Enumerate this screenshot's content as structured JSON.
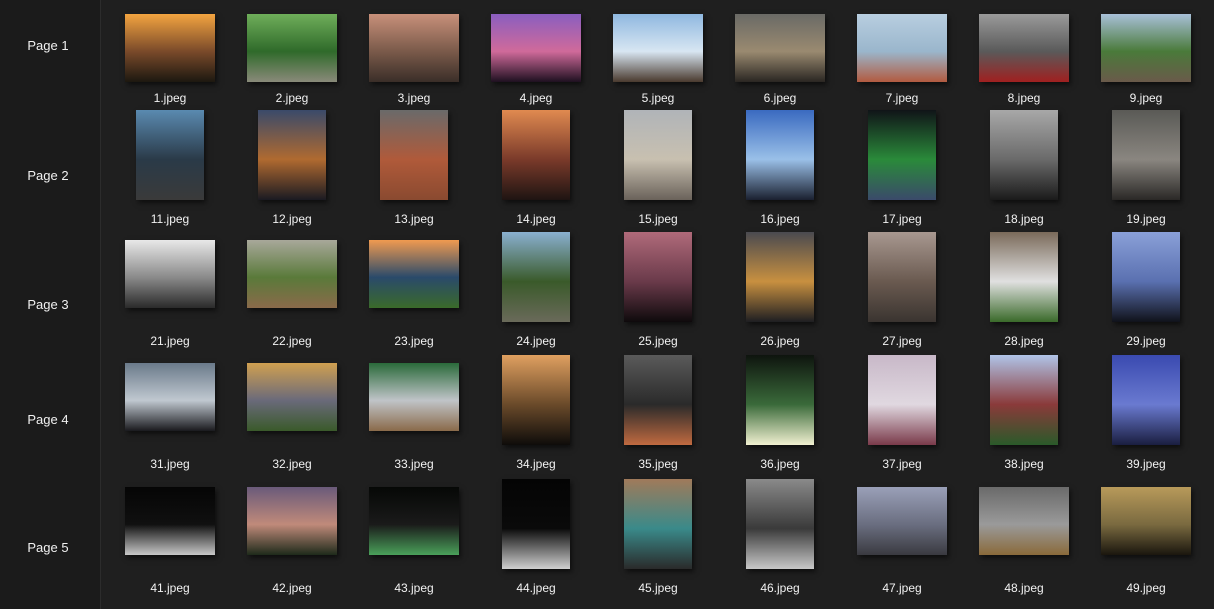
{
  "pages": [
    {
      "label": "Page 1",
      "files": [
        {
          "name": "1.jpeg",
          "orient": "landscape",
          "colors": [
            "#f3a440",
            "#7a4a2a",
            "#1c1810"
          ]
        },
        {
          "name": "2.jpeg",
          "orient": "landscape",
          "colors": [
            "#6fae5a",
            "#2f6a2a",
            "#8a8a7a"
          ]
        },
        {
          "name": "3.jpeg",
          "orient": "landscape",
          "colors": [
            "#c8907a",
            "#7a5a4a",
            "#3a2e28"
          ]
        },
        {
          "name": "4.jpeg",
          "orient": "landscape",
          "colors": [
            "#8a5ec0",
            "#d06a9a",
            "#1e1020"
          ]
        },
        {
          "name": "5.jpeg",
          "orient": "landscape",
          "colors": [
            "#8fb8e0",
            "#d8e6f2",
            "#4a3a2e"
          ]
        },
        {
          "name": "6.jpeg",
          "orient": "landscape",
          "colors": [
            "#6a6a66",
            "#9a8a70",
            "#2a2622"
          ]
        },
        {
          "name": "7.jpeg",
          "orient": "landscape",
          "colors": [
            "#b8cee0",
            "#9ab6cc",
            "#b25a40"
          ]
        },
        {
          "name": "8.jpeg",
          "orient": "landscape",
          "colors": [
            "#9a9a9a",
            "#5a5a5a",
            "#a02020"
          ]
        },
        {
          "name": "9.jpeg",
          "orient": "landscape",
          "colors": [
            "#a8c0d8",
            "#4a7a3a",
            "#6a5a4a"
          ]
        }
      ]
    },
    {
      "label": "Page 2",
      "files": [
        {
          "name": "11.jpeg",
          "orient": "portrait",
          "colors": [
            "#5a8ab0",
            "#2a3a48",
            "#3a3a3a"
          ]
        },
        {
          "name": "12.jpeg",
          "orient": "portrait",
          "colors": [
            "#3a4a6a",
            "#b06a30",
            "#1a1a22"
          ]
        },
        {
          "name": "13.jpeg",
          "orient": "portrait",
          "colors": [
            "#6a6a6a",
            "#b05a3a",
            "#8a4a30"
          ]
        },
        {
          "name": "14.jpeg",
          "orient": "portrait",
          "colors": [
            "#e08a50",
            "#7a3a2a",
            "#1e1412"
          ]
        },
        {
          "name": "15.jpeg",
          "orient": "portrait",
          "colors": [
            "#b0b4b8",
            "#c8c0b0",
            "#6a625a"
          ]
        },
        {
          "name": "16.jpeg",
          "orient": "portrait",
          "colors": [
            "#3a6ac0",
            "#9ac0e8",
            "#1a2030"
          ]
        },
        {
          "name": "17.jpeg",
          "orient": "portrait",
          "colors": [
            "#101418",
            "#2a8a3a",
            "#3a4a6a"
          ]
        },
        {
          "name": "18.jpeg",
          "orient": "portrait",
          "colors": [
            "#a8a8a8",
            "#6a6a6a",
            "#1a1a1a"
          ]
        },
        {
          "name": "19.jpeg",
          "orient": "portrait",
          "colors": [
            "#5a5a56",
            "#8a8680",
            "#2a2826"
          ]
        }
      ]
    },
    {
      "label": "Page 3",
      "files": [
        {
          "name": "21.jpeg",
          "orient": "landscape",
          "colors": [
            "#e8e8e8",
            "#8a8a8a",
            "#2a2a2a"
          ]
        },
        {
          "name": "22.jpeg",
          "orient": "landscape",
          "colors": [
            "#a8a89a",
            "#5a7a3a",
            "#8a6a4a"
          ]
        },
        {
          "name": "23.jpeg",
          "orient": "landscape",
          "colors": [
            "#f09a50",
            "#2a4a6a",
            "#3a6a2a"
          ]
        },
        {
          "name": "24.jpeg",
          "orient": "portrait",
          "colors": [
            "#8ab0d0",
            "#3a5a2a",
            "#6a6a5a"
          ]
        },
        {
          "name": "25.jpeg",
          "orient": "portrait",
          "colors": [
            "#b06a7a",
            "#6a3a4a",
            "#0e0a0c"
          ]
        },
        {
          "name": "26.jpeg",
          "orient": "portrait",
          "colors": [
            "#4a4a50",
            "#c89040",
            "#1e1e22"
          ]
        },
        {
          "name": "27.jpeg",
          "orient": "portrait",
          "colors": [
            "#a89890",
            "#6a5a50",
            "#3a3430"
          ]
        },
        {
          "name": "28.jpeg",
          "orient": "portrait",
          "colors": [
            "#7a6a5a",
            "#e0e0e0",
            "#3a6a2a"
          ]
        },
        {
          "name": "29.jpeg",
          "orient": "portrait",
          "colors": [
            "#8aa0d8",
            "#5a70b0",
            "#10121a"
          ]
        }
      ]
    },
    {
      "label": "Page 4",
      "files": [
        {
          "name": "31.jpeg",
          "orient": "landscape",
          "colors": [
            "#6a7a8a",
            "#c0c8d0",
            "#1a1a1e"
          ]
        },
        {
          "name": "32.jpeg",
          "orient": "landscape",
          "colors": [
            "#d0a050",
            "#6a6a7a",
            "#3a5a2a"
          ]
        },
        {
          "name": "33.jpeg",
          "orient": "landscape",
          "colors": [
            "#2a6a3a",
            "#c0c4c8",
            "#8a6a4a"
          ]
        },
        {
          "name": "34.jpeg",
          "orient": "portrait",
          "colors": [
            "#e0a060",
            "#6a4a2a",
            "#0e0c0a"
          ]
        },
        {
          "name": "35.jpeg",
          "orient": "portrait",
          "colors": [
            "#5a5a5a",
            "#2a2a2a",
            "#c06a40"
          ]
        },
        {
          "name": "36.jpeg",
          "orient": "portrait",
          "colors": [
            "#0e140e",
            "#3a6a3a",
            "#f0f0d0"
          ]
        },
        {
          "name": "37.jpeg",
          "orient": "portrait",
          "colors": [
            "#c8b8c8",
            "#e0d8e0",
            "#7a3a4a"
          ]
        },
        {
          "name": "38.jpeg",
          "orient": "portrait",
          "colors": [
            "#b0c4e8",
            "#8a3a3a",
            "#2a5a2a"
          ]
        },
        {
          "name": "39.jpeg",
          "orient": "portrait",
          "colors": [
            "#3a4ab0",
            "#6a7ad0",
            "#1a1e40"
          ]
        }
      ]
    },
    {
      "label": "Page 5",
      "files": [
        {
          "name": "41.jpeg",
          "orient": "landscape",
          "colors": [
            "#050505",
            "#101010",
            "#c8c8c8"
          ]
        },
        {
          "name": "42.jpeg",
          "orient": "landscape",
          "colors": [
            "#6a5a7a",
            "#c08a7a",
            "#1e2a1a"
          ]
        },
        {
          "name": "43.jpeg",
          "orient": "landscape",
          "colors": [
            "#060806",
            "#1a1a1a",
            "#4aa05a"
          ]
        },
        {
          "name": "44.jpeg",
          "orient": "portrait",
          "colors": [
            "#040404",
            "#0a0a0a",
            "#d0d0d0"
          ]
        },
        {
          "name": "45.jpeg",
          "orient": "portrait",
          "colors": [
            "#a07a5a",
            "#3a8a8a",
            "#2a2a2a"
          ]
        },
        {
          "name": "46.jpeg",
          "orient": "portrait",
          "colors": [
            "#8a8a8a",
            "#3a3a3a",
            "#c8c8c8"
          ]
        },
        {
          "name": "47.jpeg",
          "orient": "landscape",
          "colors": [
            "#9aa0b8",
            "#6a6e80",
            "#3a3a40"
          ]
        },
        {
          "name": "48.jpeg",
          "orient": "landscape",
          "colors": [
            "#6a6a6a",
            "#9a9a9a",
            "#8a6a3a"
          ]
        },
        {
          "name": "49.jpeg",
          "orient": "landscape",
          "colors": [
            "#b89a5a",
            "#7a6a40",
            "#1a160e"
          ]
        }
      ]
    }
  ]
}
